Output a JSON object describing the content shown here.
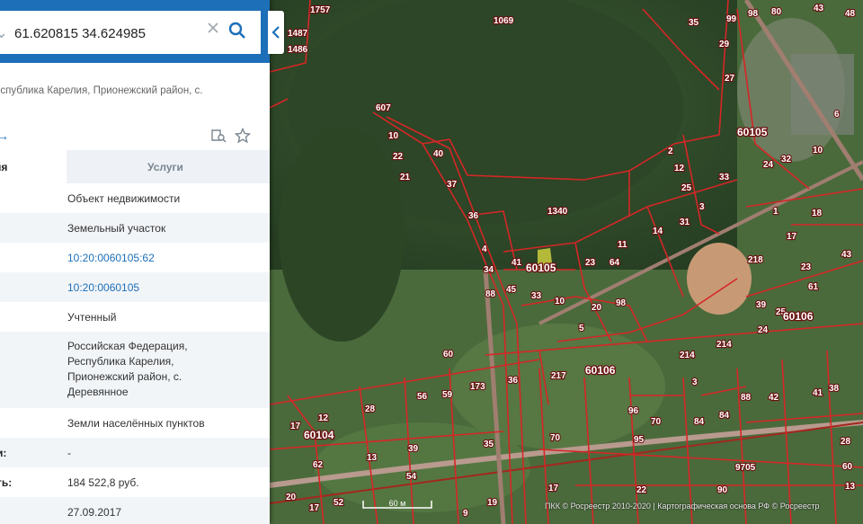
{
  "search": {
    "query": "61.620815 34.624985"
  },
  "card": {
    "address_line": "еспублика Карелия, Прионежский район, с.",
    "tabs": [
      {
        "label": "ия"
      },
      {
        "label": "Услуги"
      }
    ],
    "rows": [
      {
        "label": "",
        "value": "Объект недвижимости"
      },
      {
        "label": "",
        "value": "Земельный участок"
      },
      {
        "label": "",
        "value": "10:20:0060105:62"
      },
      {
        "label": ":",
        "value": "10:20:0060105"
      },
      {
        "label": "",
        "value": "Учтенный"
      },
      {
        "label": "",
        "value": "Российская Федерация, Республика Карелия, Прионежский район, с. Деревянное"
      },
      {
        "label": "",
        "value": "Земли населённых пунктов"
      },
      {
        "label": "и:",
        "value": "-"
      },
      {
        "label": "ть:",
        "value": "184 522,8 руб."
      },
      {
        "label": "",
        "value": "27.09.2017"
      }
    ]
  },
  "map": {
    "plots": [
      "1757",
      "1487",
      "1486",
      "1069",
      "35",
      "99",
      "98",
      "80",
      "43",
      "48",
      "29",
      "27",
      "607",
      "10",
      "22",
      "21",
      "40",
      "37",
      "36",
      "1340",
      "2",
      "12",
      "25",
      "33",
      "24",
      "32",
      "1",
      "18",
      "4",
      "41",
      "34",
      "61",
      "45",
      "33",
      "60105",
      "23",
      "64",
      "11",
      "14",
      "31",
      "17",
      "43",
      "218",
      "23",
      "61",
      "39",
      "25",
      "24",
      "60106",
      "88",
      "33",
      "20",
      "98",
      "10",
      "5",
      "214",
      "60",
      "173",
      "36",
      "217",
      "60106",
      "56",
      "59",
      "28",
      "12",
      "17",
      "60104",
      "62",
      "13",
      "39",
      "54",
      "52",
      "35",
      "96",
      "70",
      "95",
      "84",
      "84",
      "48",
      "42",
      "41",
      "38",
      "28",
      "60",
      "9705",
      "20",
      "22",
      "17",
      "36",
      "9",
      "19",
      "90",
      "3",
      "31",
      "21",
      "28"
    ],
    "quarter_labels": [
      "60105",
      "60105",
      "60106",
      "60106",
      "60104"
    ],
    "scale_label": "60 м",
    "copyright": "ПКК © Росреестр 2010-2020 | Картографическая основа РФ © Росреестр"
  }
}
